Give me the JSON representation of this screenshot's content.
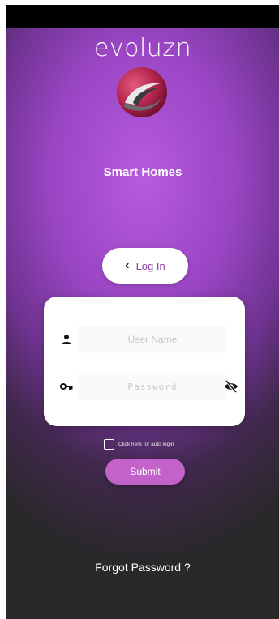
{
  "app": {
    "title": "evoluzn",
    "subtitle": "Smart Homes"
  },
  "login_tab": {
    "label": "Log In",
    "back_icon": "chevron-left-icon"
  },
  "form": {
    "username": {
      "placeholder": "User Name",
      "icon": "person-icon"
    },
    "password": {
      "placeholder": "Password",
      "icon": "key-icon",
      "toggle_icon": "eye-slash-icon"
    }
  },
  "auto_login": {
    "label": "Click here for auto login",
    "checked": false
  },
  "submit": {
    "label": "Submit"
  },
  "forgot": {
    "label": "Forgot Password ?"
  },
  "colors": {
    "accent": "#b65bdc",
    "button": "#c363c9",
    "label": "#8a3ba8",
    "background": "#2a282b"
  }
}
